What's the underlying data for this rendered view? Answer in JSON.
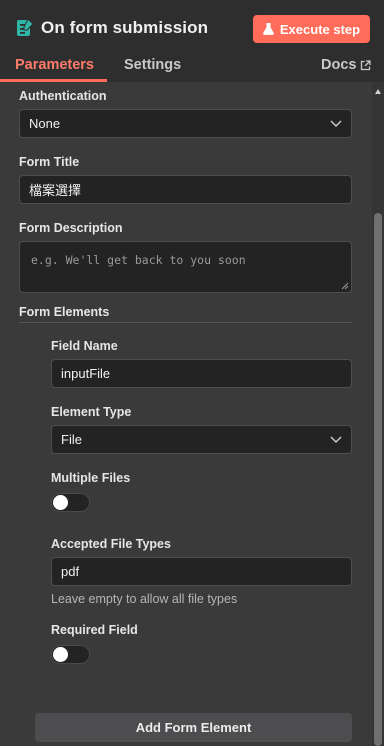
{
  "header": {
    "title": "On form submission",
    "execute_label": "Execute step",
    "tabs": {
      "parameters": "Parameters",
      "settings": "Settings",
      "docs": "Docs"
    }
  },
  "form": {
    "authentication": {
      "label": "Authentication",
      "value": "None"
    },
    "form_title": {
      "label": "Form Title",
      "value": "檔案選擇"
    },
    "form_description": {
      "label": "Form Description",
      "placeholder": "e.g. We'll get back to you soon"
    },
    "form_elements": {
      "label": "Form Elements",
      "field_name": {
        "label": "Field Name",
        "value": "inputFile"
      },
      "element_type": {
        "label": "Element Type",
        "value": "File"
      },
      "multiple_files": {
        "label": "Multiple Files",
        "enabled": false
      },
      "accepted_file_types": {
        "label": "Accepted File Types",
        "value": "pdf",
        "hint": "Leave empty to allow all file types"
      },
      "required_field": {
        "label": "Required Field",
        "enabled": false
      },
      "add_button": "Add Form Element"
    }
  },
  "colors": {
    "accent": "#ff6d5a",
    "panel_bg": "#3a3a3b",
    "header_bg": "#2e2e2f",
    "input_bg": "#232324"
  },
  "icons": {
    "node": "form-node-icon",
    "execute": "flask-icon",
    "docs": "external-link-icon",
    "dropdown": "chevron-down-icon"
  }
}
